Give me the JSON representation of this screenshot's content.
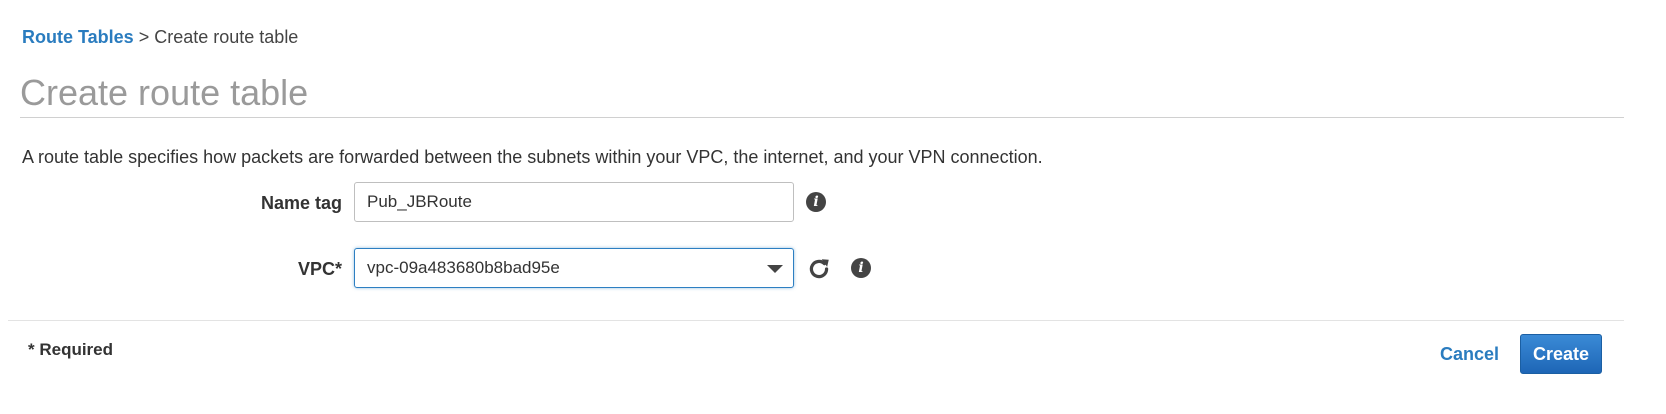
{
  "breadcrumb": {
    "link": "Route Tables",
    "separator": ">",
    "current": "Create route table"
  },
  "page": {
    "title": "Create route table",
    "description": "A route table specifies how packets are forwarded between the subnets within your VPC, the internet, and your VPN connection."
  },
  "form": {
    "name_tag": {
      "label": "Name tag",
      "value": "Pub_JBRoute"
    },
    "vpc": {
      "label": "VPC*",
      "value": "vpc-09a483680b8bad95e"
    }
  },
  "footer": {
    "required_note": "* Required",
    "cancel_label": "Cancel",
    "create_label": "Create"
  },
  "icons": {
    "info": "info-icon",
    "refresh": "refresh-icon",
    "dropdown": "chevron-down-icon"
  },
  "colors": {
    "link": "#2a7cbf",
    "primary_button": "#1f6ebf",
    "focus_border": "#2d7fc2",
    "title": "#9a9a9a"
  }
}
